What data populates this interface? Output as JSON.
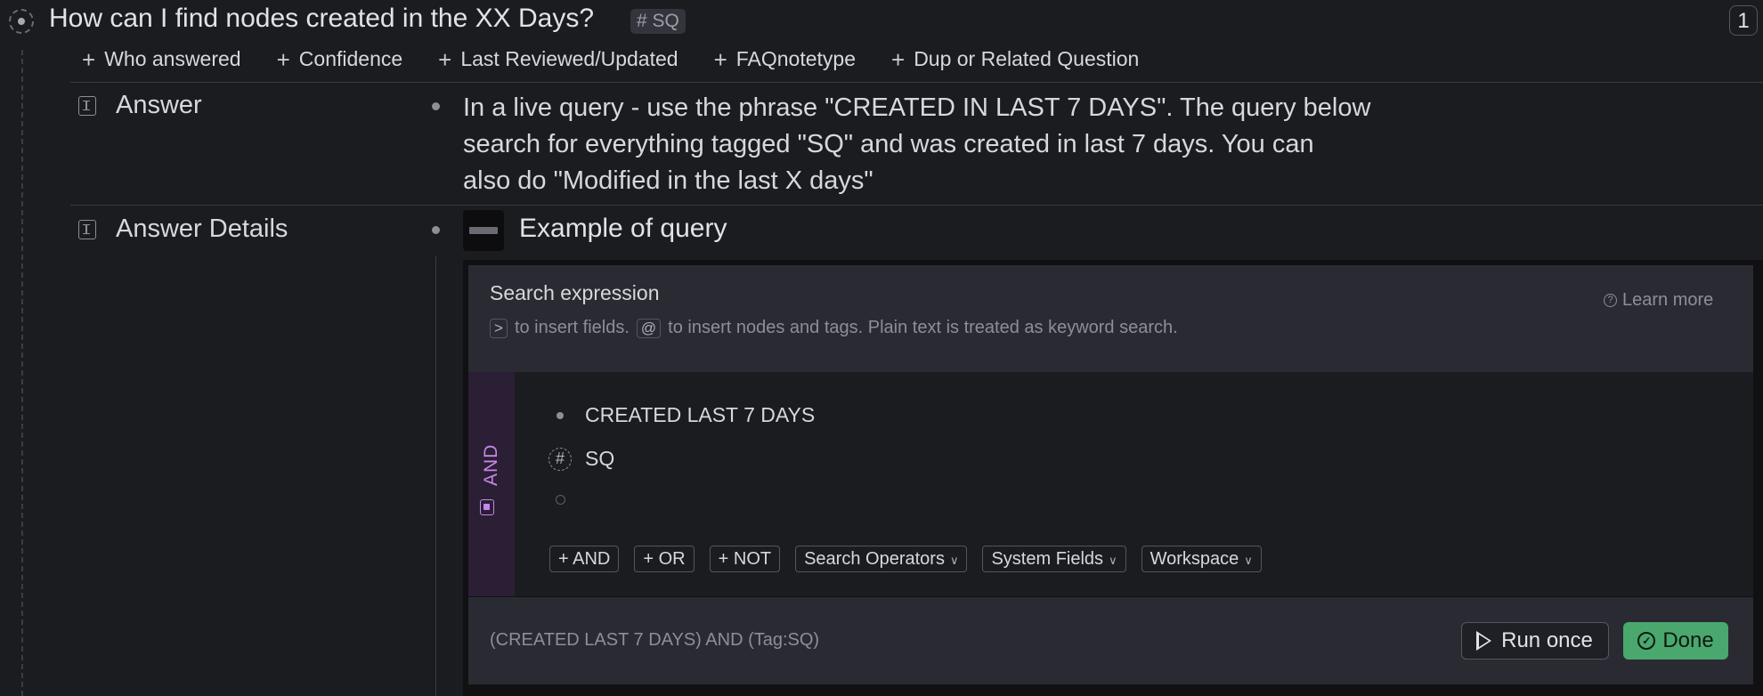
{
  "node": {
    "title": "How can I find nodes created in the XX Days?",
    "tag": "# SQ",
    "count": "1"
  },
  "field_adds": [
    "Who answered",
    "Confidence",
    "Last Reviewed/Updated",
    "FAQnotetype",
    "Dup or Related Question"
  ],
  "fields": {
    "answer": {
      "label": "Answer",
      "lines": [
        "In a live query - use the phrase \"CREATED IN LAST 7 DAYS\".  The query below",
        "search for everything tagged \"SQ\" and was created in last 7 days.   You can",
        "also do \"Modified in the last X days\""
      ]
    },
    "answer_details": {
      "label": "Answer Details",
      "example_title": "Example of query"
    }
  },
  "search_panel": {
    "title": "Search expression",
    "help_key1": ">",
    "help_text1": "to insert fields.",
    "help_key2": "@",
    "help_text2": "to insert nodes and tags. Plain text is treated as keyword search.",
    "learn_more": "Learn more",
    "operator": "AND",
    "expressions": [
      "CREATED LAST 7 DAYS",
      "SQ"
    ],
    "buttons": [
      "AND",
      "OR",
      "NOT"
    ],
    "dropdowns": [
      "Search Operators",
      "System Fields",
      "Workspace"
    ],
    "summary": "(CREATED LAST 7 DAYS) AND (Tag:SQ)",
    "run_label": "Run once",
    "done_label": "Done"
  },
  "colors": {
    "background": "#1b1c20",
    "panel": "#2a2b32",
    "and_accent": "#c787ea",
    "done_green": "#4aa86e"
  }
}
